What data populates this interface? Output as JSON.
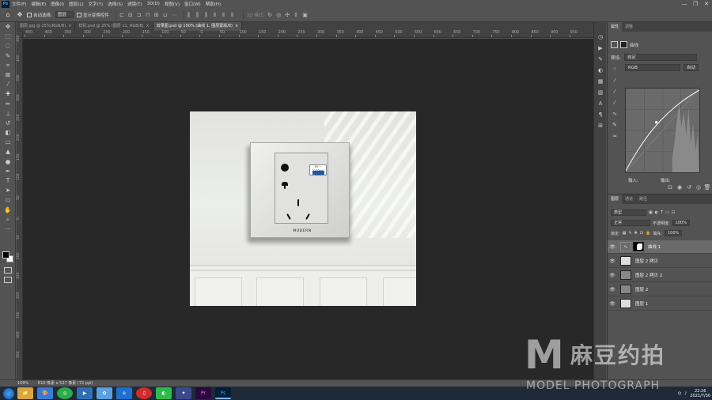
{
  "app": {
    "logo_text": "Ps"
  },
  "menu": [
    "文件(F)",
    "编辑(E)",
    "图像(I)",
    "图层(L)",
    "文字(Y)",
    "选择(S)",
    "滤镜(T)",
    "3D(D)",
    "视图(V)",
    "窗口(W)",
    "帮助(H)"
  ],
  "window_controls": {
    "minimize": "—",
    "restore": "❐",
    "close": "✕"
  },
  "options_bar": {
    "auto_select_label": "自动选择:",
    "auto_select_value": "图层",
    "show_transform_label": "显示变换控件",
    "mode_3d_label": "3D 模式:"
  },
  "tabs": [
    {
      "label": "图层.jpg @ 25%(RGB/8)",
      "active": false
    },
    {
      "label": "样机.psd @ 25% (图层 11, RGB/8)",
      "active": false
    },
    {
      "label": "效果图.psd @ 100% (曲线 1, 图层蒙版/8)",
      "active": true
    }
  ],
  "ruler_labels": [
    "450",
    "400",
    "350",
    "300",
    "250",
    "200",
    "150",
    "100",
    "50",
    "0",
    "50",
    "100",
    "150",
    "200",
    "250",
    "300",
    "350",
    "400",
    "450",
    "500",
    "550",
    "600",
    "650",
    "700",
    "750",
    "800",
    "850",
    "900",
    "950"
  ],
  "socket": {
    "usb_label": "5V ⎓ 2100mA MAX",
    "brand": "MODERN"
  },
  "properties": {
    "tabs": [
      "属性",
      "调整"
    ],
    "title": "曲线",
    "preset_label": "预设:",
    "preset_value": "自定",
    "channel_value": "RGB",
    "auto_button": "自动",
    "input_label": "输入:",
    "output_label": "输出:"
  },
  "layers_panel": {
    "tabs": [
      "图层",
      "通道",
      "路径"
    ],
    "filter_value": "类型",
    "blend_mode": "正常",
    "opacity_label": "不透明度:",
    "opacity_value": "100%",
    "lock_label": "锁定:",
    "fill_label": "填充:",
    "fill_value": "100%",
    "layers": [
      {
        "name": "曲线 1",
        "thumb": "mask",
        "active": true
      },
      {
        "name": "图层 2 拷贝",
        "thumb": "image",
        "active": false
      },
      {
        "name": "图层 2 拷贝 2",
        "thumb": "gray",
        "active": false
      },
      {
        "name": "图层 2",
        "thumb": "gray",
        "active": false
      },
      {
        "name": "图层 1",
        "thumb": "image",
        "active": false
      }
    ]
  },
  "status": {
    "zoom": "100%",
    "doc_size": "610 像素 x 527 像素 (72 ppi)"
  },
  "taskbar": {
    "apps": [
      "📁",
      "🎨",
      "◎",
      "▶",
      "✿",
      "e",
      "♫",
      "◐",
      "✦",
      "Pr",
      "Ps"
    ],
    "time": "22:26",
    "date": "2021/7/30"
  },
  "watermark": {
    "big": "M",
    "cn": "麻豆约拍",
    "en": "MODEL PHOTOGRAPH"
  },
  "colors": {
    "ps_blue": "#31a8ff",
    "canvas_bg": "#282828",
    "panel": "#535353"
  }
}
